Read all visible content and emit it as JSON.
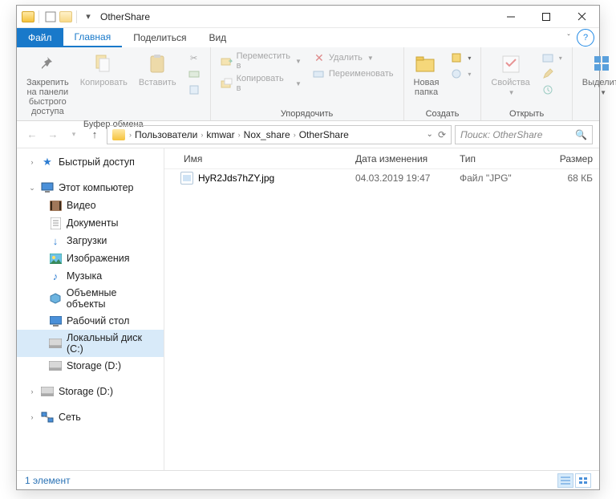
{
  "title": "OtherShare",
  "tabs": {
    "file": "Файл",
    "home": "Главная",
    "share": "Поделиться",
    "view": "Вид"
  },
  "ribbon": {
    "clipboard": {
      "pin": "Закрепить на панели\nбыстрого доступа",
      "copy": "Копировать",
      "paste": "Вставить",
      "label": "Буфер обмена"
    },
    "organize": {
      "moveto": "Переместить в",
      "copyto": "Копировать в",
      "delete": "Удалить",
      "rename": "Переименовать",
      "label": "Упорядочить"
    },
    "new": {
      "newfolder": "Новая\nпапка",
      "label": "Создать"
    },
    "open": {
      "properties": "Свойства",
      "label": "Открыть"
    },
    "select": {
      "select": "Выделить",
      "label": ""
    }
  },
  "breadcrumb": [
    "Пользователи",
    "kmwar",
    "Nox_share",
    "OtherShare"
  ],
  "search_placeholder": "Поиск: OtherShare",
  "nav": {
    "quick": "Быстрый доступ",
    "thispc": "Этот компьютер",
    "items": [
      "Видео",
      "Документы",
      "Загрузки",
      "Изображения",
      "Музыка",
      "Объемные объекты",
      "Рабочий стол",
      "Локальный диск (C:)",
      "Storage (D:)"
    ],
    "storage2": "Storage (D:)",
    "network": "Сеть"
  },
  "columns": {
    "name": "Имя",
    "date": "Дата изменения",
    "type": "Тип",
    "size": "Размер"
  },
  "file": {
    "name": "HyR2Jds7hZY.jpg",
    "date": "04.03.2019 19:47",
    "type": "Файл \"JPG\"",
    "size": "68 КБ"
  },
  "status": "1 элемент"
}
